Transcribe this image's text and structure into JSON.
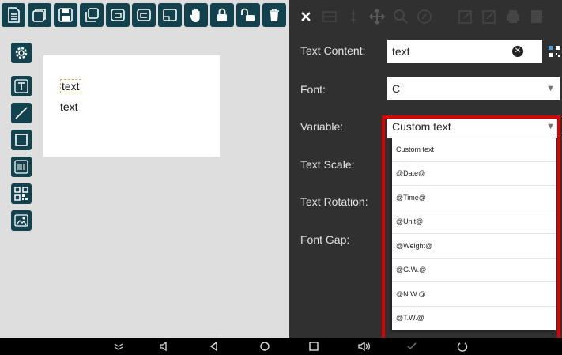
{
  "toolbar": {
    "icons": [
      "document-icon",
      "layers-icon",
      "save-icon",
      "copy-icon",
      "undo-icon",
      "redo-icon",
      "frame-icon",
      "hand-icon",
      "lock-icon",
      "unlock-icon",
      "trash-icon"
    ]
  },
  "sidebar": {
    "icons": [
      "gear-icon",
      "text-tool-icon",
      "line-tool-icon",
      "rectangle-tool-icon",
      "barcode-tool-icon",
      "qr-tool-icon",
      "image-tool-icon"
    ]
  },
  "canvas": {
    "items": [
      "text",
      "text"
    ]
  },
  "right_toolbar": {
    "icons": [
      "close-icon",
      "align-horizontal-icon",
      "align-vertical-icon",
      "move-icon",
      "zoom-icon",
      "rotate-icon",
      "export-icon",
      "edit-icon",
      "print-icon",
      "settings-icon"
    ]
  },
  "properties": {
    "text_content_label": "Text Content:",
    "text_content_value": "text",
    "font_label": "Font:",
    "font_value": "C",
    "variable_label": "Variable:",
    "variable_value": "Custom text",
    "text_scale_label": "Text Scale:",
    "text_rotation_label": "Text Rotation:",
    "font_gap_label": "Font Gap:"
  },
  "variable_dropdown": {
    "options": [
      "Custom text",
      "@Date@",
      "@Time@",
      "@Unit@",
      "@Weight@",
      "@G.W.@",
      "@N.W.@",
      "@T.W.@"
    ]
  },
  "colors": {
    "toolbar_button": "#13424f",
    "panel_bg": "#303030",
    "editor_bg": "#dedede",
    "highlight": "#e00000"
  }
}
